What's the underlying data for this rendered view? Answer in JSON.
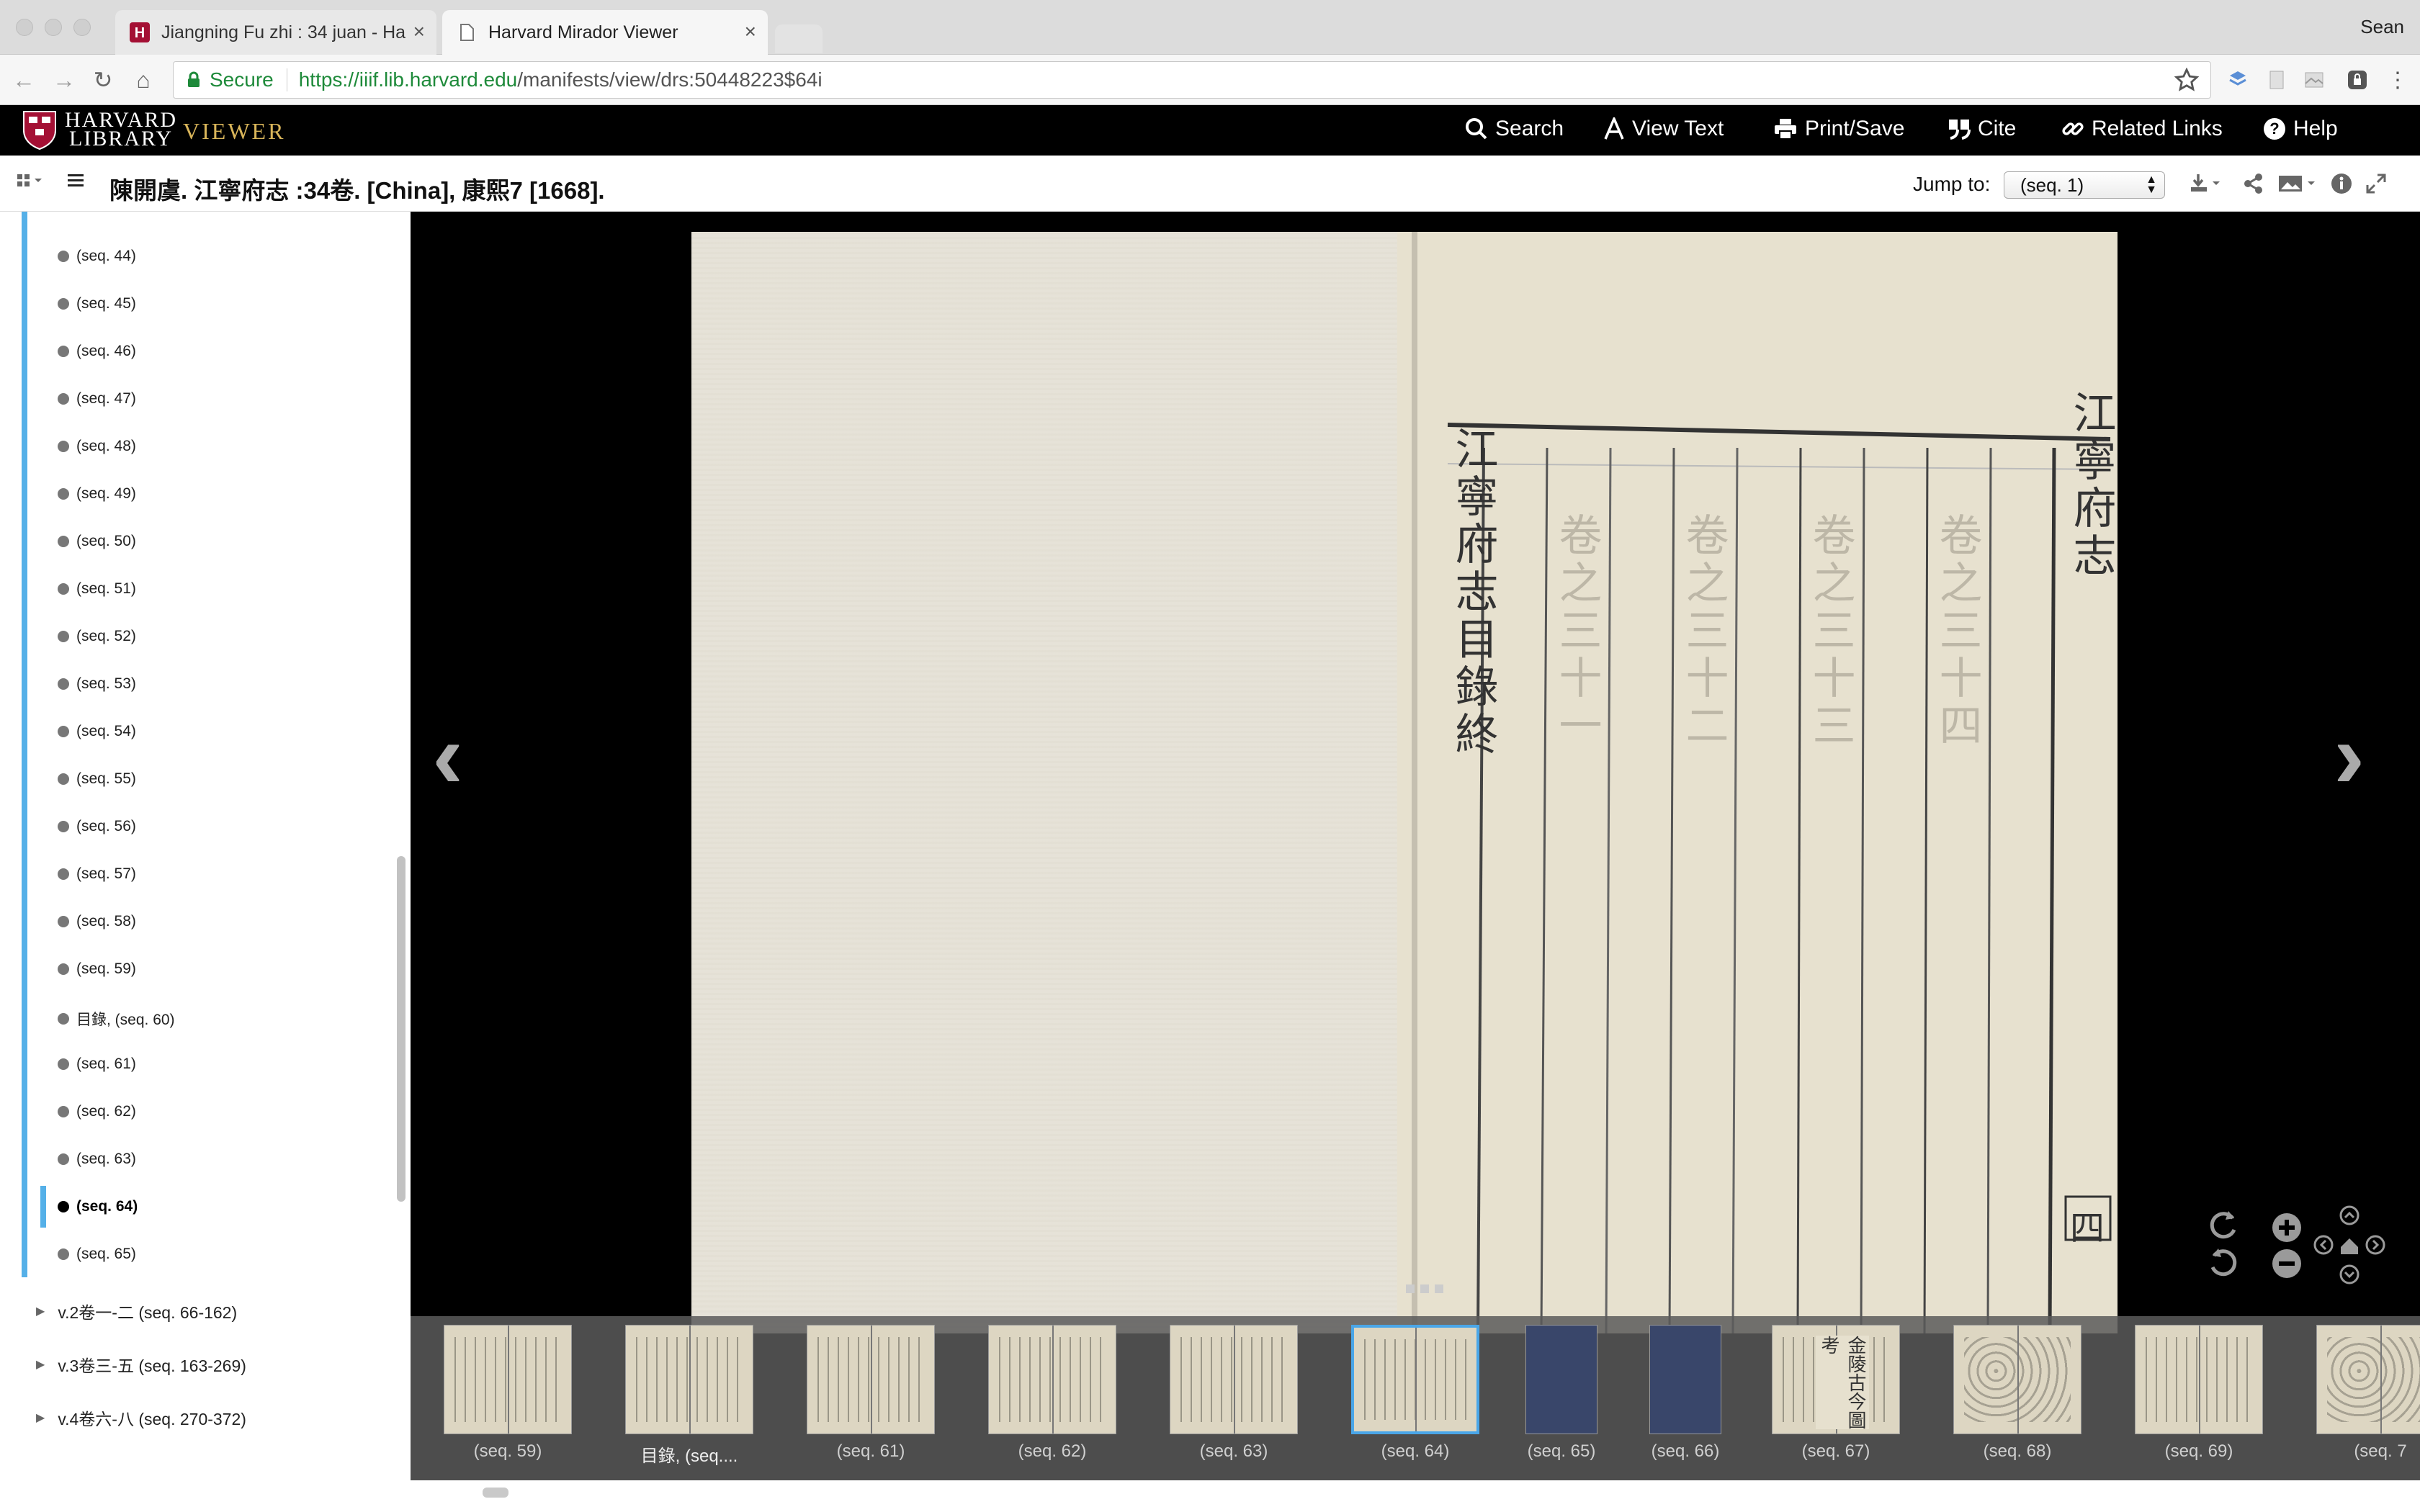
{
  "browser": {
    "tabs": [
      {
        "title": "Jiangning Fu zhi : 34 juan - Ha",
        "active": false
      },
      {
        "title": "Harvard Mirador Viewer",
        "active": true
      }
    ],
    "user": "Sean",
    "secure_label": "Secure",
    "url_host": "https://iiif.lib.harvard.edu",
    "url_path": "/manifests/view/drs:50448223$64i"
  },
  "header": {
    "logo_line1": "HARVARD",
    "logo_line2": "LIBRARY",
    "viewer_label": "VIEWER",
    "nav": [
      {
        "label": "Search",
        "icon": "search-icon"
      },
      {
        "label": "View Text",
        "icon": "text-icon"
      },
      {
        "label": "Print/Save",
        "icon": "print-icon"
      },
      {
        "label": "Cite",
        "icon": "quote-icon"
      },
      {
        "label": "Related Links",
        "icon": "link-icon"
      },
      {
        "label": "Help",
        "icon": "help-icon"
      }
    ]
  },
  "titlebar": {
    "title": "陳開虞. 江寧府志 :34卷. [China], 康熙7 [1668].",
    "jump_label": "Jump to:",
    "jump_value": "(seq. 1)"
  },
  "sidebar": {
    "items": [
      "(seq. 44)",
      "(seq. 45)",
      "(seq. 46)",
      "(seq. 47)",
      "(seq. 48)",
      "(seq. 49)",
      "(seq. 50)",
      "(seq. 51)",
      "(seq. 52)",
      "(seq. 53)",
      "(seq. 54)",
      "(seq. 55)",
      "(seq. 56)",
      "(seq. 57)",
      "(seq. 58)",
      "(seq. 59)",
      "目錄, (seq. 60)",
      "(seq. 61)",
      "(seq. 62)",
      "(seq. 63)",
      "(seq. 64)",
      "(seq. 65)"
    ],
    "selected_index": 20,
    "volumes": [
      "v.2卷一-二 (seq. 66-162)",
      "v.3卷三-五 (seq. 163-269)",
      "v.4卷六-八 (seq. 270-372)"
    ]
  },
  "book_text": {
    "columns": [
      "江寧府志目錄終",
      "卷之三十一",
      "卷之三十二",
      "卷之三十三",
      "卷之三十四"
    ],
    "edge_text": "江寧府志",
    "page_number": "四"
  },
  "thumbnails": [
    {
      "label": "(seq. 59)",
      "style": "text"
    },
    {
      "label": "目錄, (seq....",
      "style": "text"
    },
    {
      "label": "(seq. 61)",
      "style": "text"
    },
    {
      "label": "(seq. 62)",
      "style": "text"
    },
    {
      "label": "(seq. 63)",
      "style": "text"
    },
    {
      "label": "(seq. 64)",
      "style": "text"
    },
    {
      "label": "(seq. 65)",
      "style": "blue"
    },
    {
      "label": "(seq. 66)",
      "style": "blue"
    },
    {
      "label": "(seq. 67)",
      "style": "title"
    },
    {
      "label": "(seq. 68)",
      "style": "map"
    },
    {
      "label": "(seq. 69)",
      "style": "text"
    },
    {
      "label": "(seq. 7",
      "style": "map"
    }
  ],
  "thumbnail_selected_index": 5,
  "thumb_67_title": "金陵古今圖考",
  "colors": {
    "accent": "#55b0e8",
    "header_bg": "#000000",
    "viewer_gold": "#d9b55a"
  }
}
